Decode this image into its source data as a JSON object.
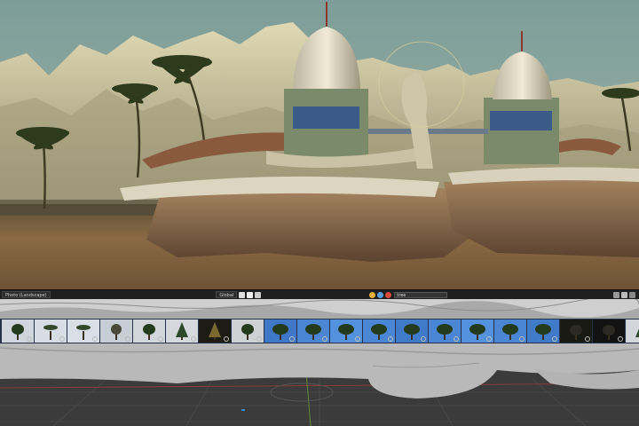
{
  "toolbar": {
    "left_dropdown": "Photo (Landscape)",
    "center_dropdown": "Global",
    "filter_value": "tree",
    "icons": [
      "render-icon",
      "camera-icon",
      "light-icon",
      "globe-icon",
      "grid-icon",
      "filter-icon",
      "funnel-icon",
      "settings-icon"
    ]
  },
  "asset_tray": {
    "items": [
      {
        "kind": "tree",
        "bg": "#cfd6de"
      },
      {
        "kind": "palm",
        "bg": "#d6dde4"
      },
      {
        "kind": "palm",
        "bg": "#d8dfe6"
      },
      {
        "kind": "bare",
        "bg": "#c7ced6"
      },
      {
        "kind": "tree",
        "bg": "#d2d6da"
      },
      {
        "kind": "conifer",
        "bg": "#d5d8dc"
      },
      {
        "kind": "pine",
        "bg": "#1c1b14"
      },
      {
        "kind": "tree",
        "bg": "#cfd2d5"
      },
      {
        "kind": "oak",
        "bg": "#3f78c9"
      },
      {
        "kind": "oak",
        "bg": "#4a86d4"
      },
      {
        "kind": "oak",
        "bg": "#5592de"
      },
      {
        "kind": "oak",
        "bg": "#4a86d4"
      },
      {
        "kind": "oak",
        "bg": "#3f7bc8"
      },
      {
        "kind": "oak",
        "bg": "#4a86d4"
      },
      {
        "kind": "oak",
        "bg": "#5592de"
      },
      {
        "kind": "oak",
        "bg": "#4a86d4"
      },
      {
        "kind": "oak",
        "bg": "#3f7bc8"
      },
      {
        "kind": "dark",
        "bg": "#1a1a14"
      },
      {
        "kind": "dark",
        "bg": "#121212"
      },
      {
        "kind": "conifer",
        "bg": "#d2d6da"
      },
      {
        "kind": "tree",
        "bg": "#cfd3d7"
      },
      {
        "kind": "tree",
        "bg": "#2e61b0"
      }
    ]
  },
  "colors": {
    "sky": "#8ba9a2",
    "mountain": "#c8c29a",
    "desert": "#7a5e3c",
    "rock": "#8a6a4a",
    "tray": "#25324a",
    "grid": "#3a3a3a"
  }
}
